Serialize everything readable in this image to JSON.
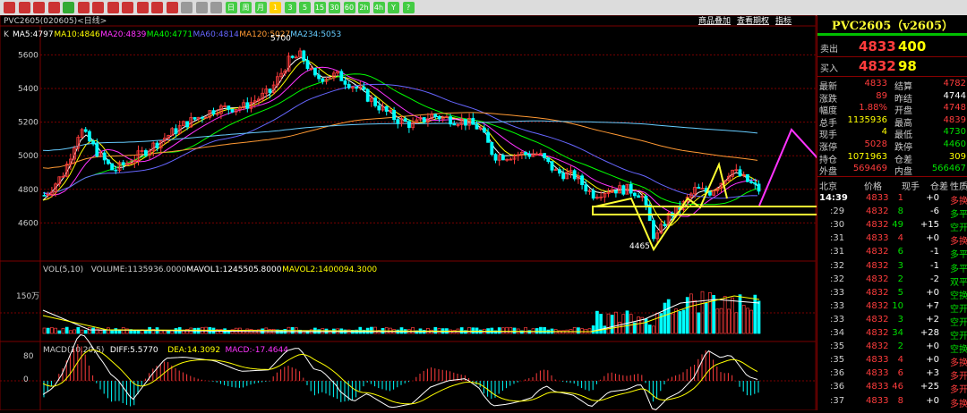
{
  "toolbar": {
    "buttons": [
      "home-icon",
      "back-icon",
      "forward-icon",
      "f10-icon",
      "refresh-icon",
      "zoom-in-icon",
      "zoom-out-icon",
      "pen-icon",
      "draw-icon",
      "ruler-icon",
      "filter-icon",
      "ruler2-icon",
      "table-icon",
      "list-icon",
      "kline-icon",
      "period-day",
      "period-week",
      "period-month",
      "period-1m",
      "period-3m",
      "period-5m",
      "period-15m",
      "period-30m",
      "period-60m",
      "period-2h",
      "period-4h",
      "period-y",
      "period-custom"
    ],
    "period_labels": [
      "日",
      "周",
      "月",
      "1",
      "3",
      "5",
      "15",
      "30",
      "60",
      "2h",
      "4h",
      "Y",
      "?"
    ]
  },
  "chart": {
    "symbol_label": "PVC2605(020605)<日线>",
    "top_links": [
      "商品叠加",
      "查看期权",
      "指标"
    ],
    "ma_prefix": "K",
    "ma": [
      {
        "label": "MA5:4797",
        "color": "#ffffff"
      },
      {
        "label": "MA10:4846",
        "color": "#ffff00"
      },
      {
        "label": "MA20:4839",
        "color": "#ff33ff"
      },
      {
        "label": "MA40:4771",
        "color": "#00ff00"
      },
      {
        "label": "MA60:4814",
        "color": "#6666ff"
      },
      {
        "label": "MA120:5027",
        "color": "#ff9933"
      },
      {
        "label": "MA234:5053",
        "color": "#66ccff"
      }
    ],
    "y_ticks": [
      "5600",
      "5400",
      "5200",
      "5000",
      "4800",
      "4600"
    ],
    "high_label": "5700",
    "low_label": "4465",
    "vol_header": [
      {
        "label": "VOL(5,10)",
        "color": "#cccccc"
      },
      {
        "label": "VOLUME:1135936.0000",
        "color": "#cccccc"
      },
      {
        "label": "MAVOL1:1245505.8000",
        "color": "#ffffff"
      },
      {
        "label": "MAVOL2:1400094.3000",
        "color": "#ffff00"
      }
    ],
    "vol_tick": "150万",
    "macd_header": [
      {
        "label": "MACD(10,20,5)",
        "color": "#cccccc"
      },
      {
        "label": "DIFF:5.5770",
        "color": "#ffffff"
      },
      {
        "label": "DEA:14.3092",
        "color": "#ffff00"
      },
      {
        "label": "MACD:-17.4644",
        "color": "#ff33ff"
      }
    ],
    "macd_ticks": [
      "80",
      "0"
    ]
  },
  "panel": {
    "title": "PVC2605（v2605）",
    "sell_label": "卖出",
    "sell_price": "4833",
    "sell_vol": "400",
    "buy_label": "买入",
    "buy_price": "4832",
    "buy_vol": "98",
    "stats": [
      {
        "l1": "最新",
        "v1": "4833",
        "c1": "red",
        "l2": "结算",
        "v2": "4782",
        "c2": "red"
      },
      {
        "l1": "涨跌",
        "v1": "89",
        "c1": "red",
        "l2": "昨结",
        "v2": "4744",
        "c2": "white"
      },
      {
        "l1": "幅度",
        "v1": "1.88%",
        "c1": "red",
        "l2": "开盘",
        "v2": "4748",
        "c2": "red"
      },
      {
        "l1": "总手",
        "v1": "1135936",
        "c1": "yellow",
        "l2": "最高",
        "v2": "4839",
        "c2": "red"
      },
      {
        "l1": "现手",
        "v1": "4",
        "c1": "yellow",
        "l2": "最低",
        "v2": "4730",
        "c2": "green"
      },
      {
        "l1": "涨停",
        "v1": "5028",
        "c1": "red",
        "l2": "跌停",
        "v2": "4460",
        "c2": "green"
      },
      {
        "l1": "持仓",
        "v1": "1071963",
        "c1": "yellow",
        "l2": "仓差",
        "v2": "309",
        "c2": "yellow"
      },
      {
        "l1": "外盘",
        "v1": "569469",
        "c1": "red",
        "l2": "内盘",
        "v2": "566467",
        "c2": "green"
      }
    ],
    "tick_header": [
      "北京",
      "价格",
      "现手",
      "仓差",
      "性质"
    ],
    "ticks": [
      {
        "t": "14:39",
        "p": "4833",
        "pc": "red",
        "v": "1",
        "vc": "red",
        "d": "+0",
        "nature": "多换",
        "nc": "red"
      },
      {
        "t": ":29",
        "p": "4832",
        "pc": "red",
        "v": "8",
        "vc": "green",
        "d": "-6",
        "nature": "多平",
        "nc": "green"
      },
      {
        "t": ":30",
        "p": "4832",
        "pc": "red",
        "v": "49",
        "vc": "green",
        "d": "+15",
        "nature": "空开",
        "nc": "green"
      },
      {
        "t": ":31",
        "p": "4833",
        "pc": "red",
        "v": "4",
        "vc": "red",
        "d": "+0",
        "nature": "多换",
        "nc": "red"
      },
      {
        "t": ":31",
        "p": "4832",
        "pc": "red",
        "v": "6",
        "vc": "green",
        "d": "-1",
        "nature": "多平",
        "nc": "green"
      },
      {
        "t": ":32",
        "p": "4832",
        "pc": "red",
        "v": "3",
        "vc": "green",
        "d": "-1",
        "nature": "多平",
        "nc": "green"
      },
      {
        "t": ":32",
        "p": "4832",
        "pc": "red",
        "v": "2",
        "vc": "green",
        "d": "-2",
        "nature": "双平",
        "nc": "green"
      },
      {
        "t": ":33",
        "p": "4832",
        "pc": "red",
        "v": "5",
        "vc": "green",
        "d": "+0",
        "nature": "空换",
        "nc": "green"
      },
      {
        "t": ":33",
        "p": "4832",
        "pc": "red",
        "v": "10",
        "vc": "green",
        "d": "+7",
        "nature": "空开",
        "nc": "green"
      },
      {
        "t": ":33",
        "p": "4832",
        "pc": "red",
        "v": "3",
        "vc": "green",
        "d": "+2",
        "nature": "空开",
        "nc": "green"
      },
      {
        "t": ":34",
        "p": "4832",
        "pc": "red",
        "v": "34",
        "vc": "green",
        "d": "+28",
        "nature": "空开",
        "nc": "green"
      },
      {
        "t": ":35",
        "p": "4832",
        "pc": "red",
        "v": "2",
        "vc": "green",
        "d": "+0",
        "nature": "空换",
        "nc": "green"
      },
      {
        "t": ":35",
        "p": "4833",
        "pc": "red",
        "v": "4",
        "vc": "red",
        "d": "+0",
        "nature": "多换",
        "nc": "red"
      },
      {
        "t": ":36",
        "p": "4833",
        "pc": "red",
        "v": "6",
        "vc": "red",
        "d": "+3",
        "nature": "多开",
        "nc": "red"
      },
      {
        "t": ":36",
        "p": "4833",
        "pc": "red",
        "v": "46",
        "vc": "red",
        "d": "+25",
        "nature": "多开",
        "nc": "red"
      },
      {
        "t": ":37",
        "p": "4833",
        "pc": "red",
        "v": "8",
        "vc": "red",
        "d": "+0",
        "nature": "多换",
        "nc": "red"
      }
    ]
  },
  "colors": {
    "up": "#ff3c3c",
    "down": "#00ffff",
    "grid": "#7a0000",
    "annotation": "#ffff33",
    "projection": "#ff33ff"
  }
}
